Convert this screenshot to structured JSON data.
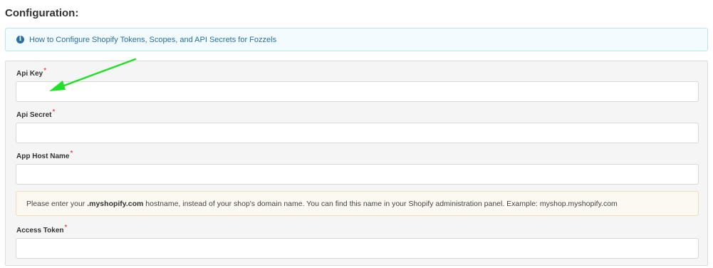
{
  "page": {
    "title": "Configuration:"
  },
  "info": {
    "icon": "info-circle-icon",
    "link_text": "How to Configure Shopify Tokens, Scopes, and API Secrets for Fozzels",
    "accent": "#2a6ea6"
  },
  "fields": {
    "api_key": {
      "label": "Api Key",
      "required": "*",
      "value": "",
      "placeholder": ""
    },
    "api_secret": {
      "label": "Api Secret",
      "required": "*",
      "value": "",
      "placeholder": ""
    },
    "app_host_name": {
      "label": "App Host Name",
      "required": "*",
      "value": "",
      "placeholder": ""
    },
    "access_token": {
      "label": "Access Token",
      "required": "*",
      "value": "",
      "placeholder": ""
    }
  },
  "hint": {
    "prefix": "Please enter your ",
    "bold": ".myshopify.com",
    "suffix": " hostname, instead of your shop's domain name. You can find this name in your Shopify administration panel. Example: myshop.myshopify.com"
  },
  "annotation": {
    "arrow_color": "#22e02a",
    "icon": "green-arrow-icon"
  },
  "colors": {
    "required": "#d9231f",
    "warning_bg": "#fcf8f2",
    "info_bg": "#f2fbfd"
  }
}
